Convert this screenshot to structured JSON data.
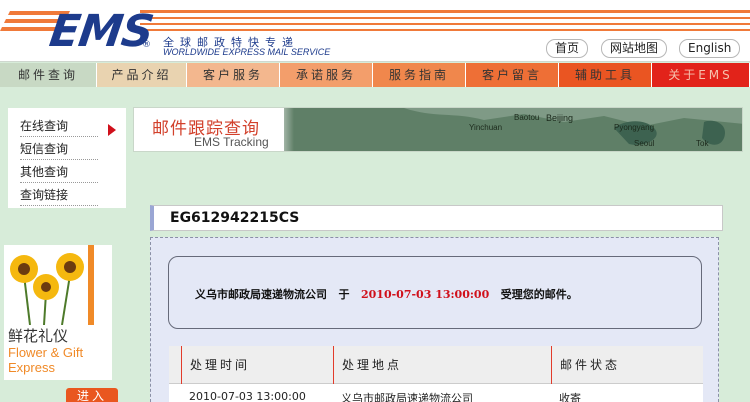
{
  "header": {
    "logo": "EMS",
    "logo_mark": "®",
    "tagline_cn": "全球邮政特快专递",
    "tagline_en": "WORLDWIDE EXPRESS MAIL SERVICE",
    "buttons": [
      "首页",
      "网站地图",
      "English"
    ]
  },
  "nav": {
    "items": [
      {
        "label": "邮件查询",
        "color": "#c8d9c4"
      },
      {
        "label": "产品介绍",
        "color": "#e9d3b0"
      },
      {
        "label": "客户服务",
        "color": "#f3b78e"
      },
      {
        "label": "承诺服务",
        "color": "#f39e6b"
      },
      {
        "label": "服务指南",
        "color": "#f0874c"
      },
      {
        "label": "客户留言",
        "color": "#ee6f36"
      },
      {
        "label": "辅助工具",
        "color": "#ea5522"
      },
      {
        "label": "关于EMS",
        "color": "#e2231a"
      }
    ]
  },
  "sidebar": {
    "items": [
      "在线查询",
      "短信查询",
      "其他查询",
      "查询链接"
    ],
    "active_index": 0
  },
  "promo": {
    "title_cn": "鲜花礼仪",
    "title_en_1": "Flower & Gift",
    "title_en_2": "Express",
    "enter_label": "进入"
  },
  "banner": {
    "title": "邮件跟踪查询",
    "subtitle": "EMS Tracking",
    "map_labels": [
      "Baotou",
      "Beijing",
      "Pyongyang",
      "Yinchuan",
      "Seoul",
      "Tok"
    ]
  },
  "tracking": {
    "number": "EG612942215CS"
  },
  "notice": {
    "office": "义乌市邮政局速递物流公司",
    "connector": "于",
    "datetime": "2010-07-03 13:00:00",
    "suffix": "受理您的邮件。"
  },
  "table": {
    "headers": [
      "处理时间",
      "处理地点",
      "邮件状态"
    ],
    "rows": [
      {
        "time": "2010-07-03  13:00:00",
        "location": "义乌市邮政局速递物流公司",
        "status": "收寄"
      }
    ]
  }
}
